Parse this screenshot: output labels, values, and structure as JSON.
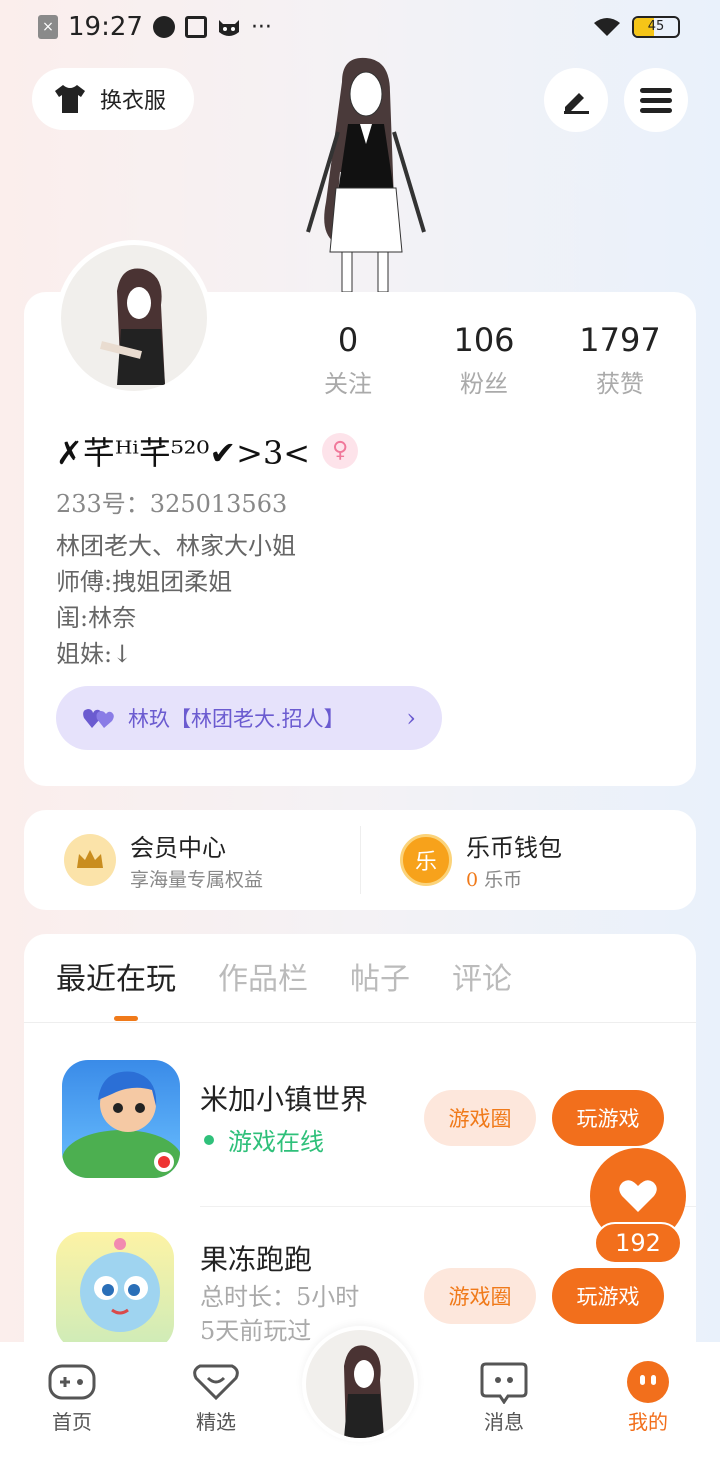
{
  "status_bar": {
    "time": "19:27",
    "battery": "45",
    "battery_level": 0.45,
    "more": "···"
  },
  "header": {
    "outfit_label": "换衣服"
  },
  "profile": {
    "stats": [
      {
        "value": "0",
        "label": "关注"
      },
      {
        "value": "106",
        "label": "粉丝"
      },
      {
        "value": "1797",
        "label": "获赞"
      }
    ],
    "nickname": "✗芊ᴴⁱ芊⁵²⁰✔>3<",
    "gender_symbol": "♀",
    "uid": "233号：325013563",
    "bio": [
      "林团老大、林家大小姐",
      "师傅:拽姐团柔姐",
      "闺:林奈",
      "姐妹:↓"
    ],
    "guild_label": "林玖【林团老大.招人】",
    "guild_chevron": "›"
  },
  "member": {
    "title": "会员中心",
    "subtitle": "享海量专属权益"
  },
  "wallet": {
    "title": "乐币钱包",
    "icon_text": "乐",
    "amount": "0",
    "unit": "乐币"
  },
  "tabs": [
    "最近在玩",
    "作品栏",
    "帖子",
    "评论"
  ],
  "games": [
    {
      "name": "米加小镇世界",
      "status": "游戏在线",
      "circle_label": "游戏圈",
      "play_label": "玩游戏"
    },
    {
      "name": "果冻跑跑",
      "meta_1": "总时长：5小时",
      "meta_2": "5天前玩过",
      "circle_label": "游戏圈",
      "play_label": "玩游戏"
    }
  ],
  "like_count": "192",
  "nav": {
    "home": "首页",
    "featured": "精选",
    "messages": "消息",
    "mine": "我的"
  },
  "colors": {
    "accent": "#f26f1c",
    "online": "#2fc07a",
    "guild": "#6b5bd0"
  }
}
